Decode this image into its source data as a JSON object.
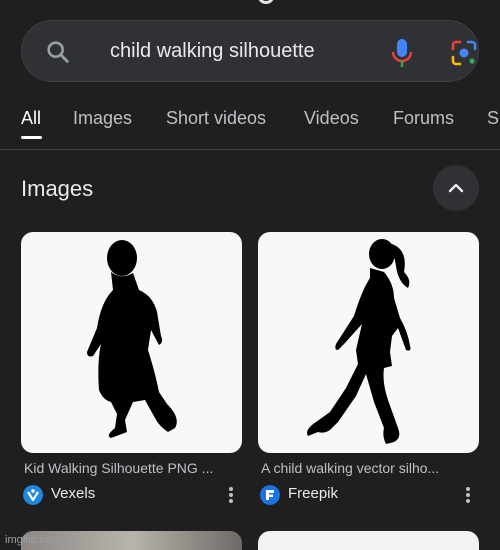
{
  "search": {
    "query": "child walking silhouette"
  },
  "tabs": [
    {
      "label": "All",
      "active": true
    },
    {
      "label": "Images"
    },
    {
      "label": "Short videos"
    },
    {
      "label": "Videos"
    },
    {
      "label": "Forums"
    },
    {
      "label": "Sh"
    }
  ],
  "images_section": {
    "title": "Images",
    "collapse_icon": "chevron-up-icon"
  },
  "results": [
    {
      "title": "Kid Walking Silhouette PNG ...",
      "source": "Vexels",
      "source_icon": "vexels-logo",
      "icon_color": "#1e88e5"
    },
    {
      "title": "A child walking vector silho...",
      "source": "Freepik",
      "source_icon": "freepik-logo",
      "icon_color": "#1a73e8"
    }
  ],
  "watermark": "imgflip.com",
  "colors": {
    "background": "#1f1f1f",
    "search_bg": "#303134",
    "text_primary": "#e8eaed",
    "text_secondary": "#bdc1c6"
  }
}
